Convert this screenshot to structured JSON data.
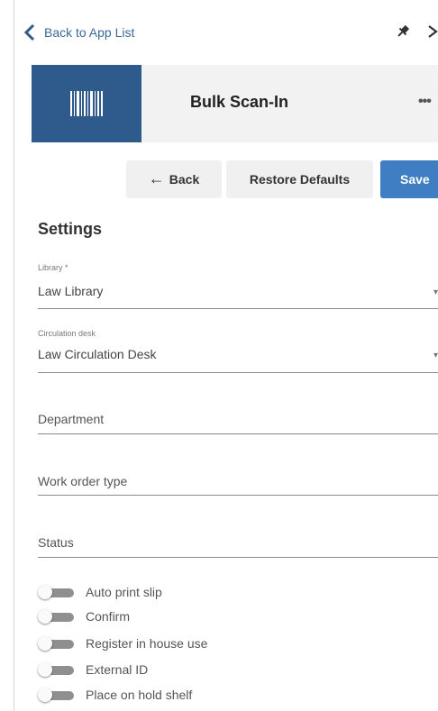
{
  "nav": {
    "back_label": "Back to App List"
  },
  "app": {
    "title": "Bulk Scan-In",
    "tile_icon": "barcode-icon",
    "tile_color": "#2e5b8c"
  },
  "toolbar": {
    "back_label": "Back",
    "restore_label": "Restore Defaults",
    "save_label": "Save",
    "save_color": "#3f7ec2"
  },
  "settings": {
    "title": "Settings",
    "library": {
      "label": "Library *",
      "value": "Law Library"
    },
    "circulation_desk": {
      "label": "Circulation desk",
      "value": "Law Circulation Desk"
    },
    "department": {
      "placeholder": "Department"
    },
    "work_order_type": {
      "placeholder": "Work order type"
    },
    "status": {
      "placeholder": "Status"
    },
    "toggles": [
      {
        "label": "Auto print slip",
        "on": false
      },
      {
        "label": "Confirm",
        "on": false
      },
      {
        "label": "Register in house use",
        "on": false
      },
      {
        "label": "External ID",
        "on": false
      },
      {
        "label": "Place on hold shelf",
        "on": false
      }
    ]
  }
}
